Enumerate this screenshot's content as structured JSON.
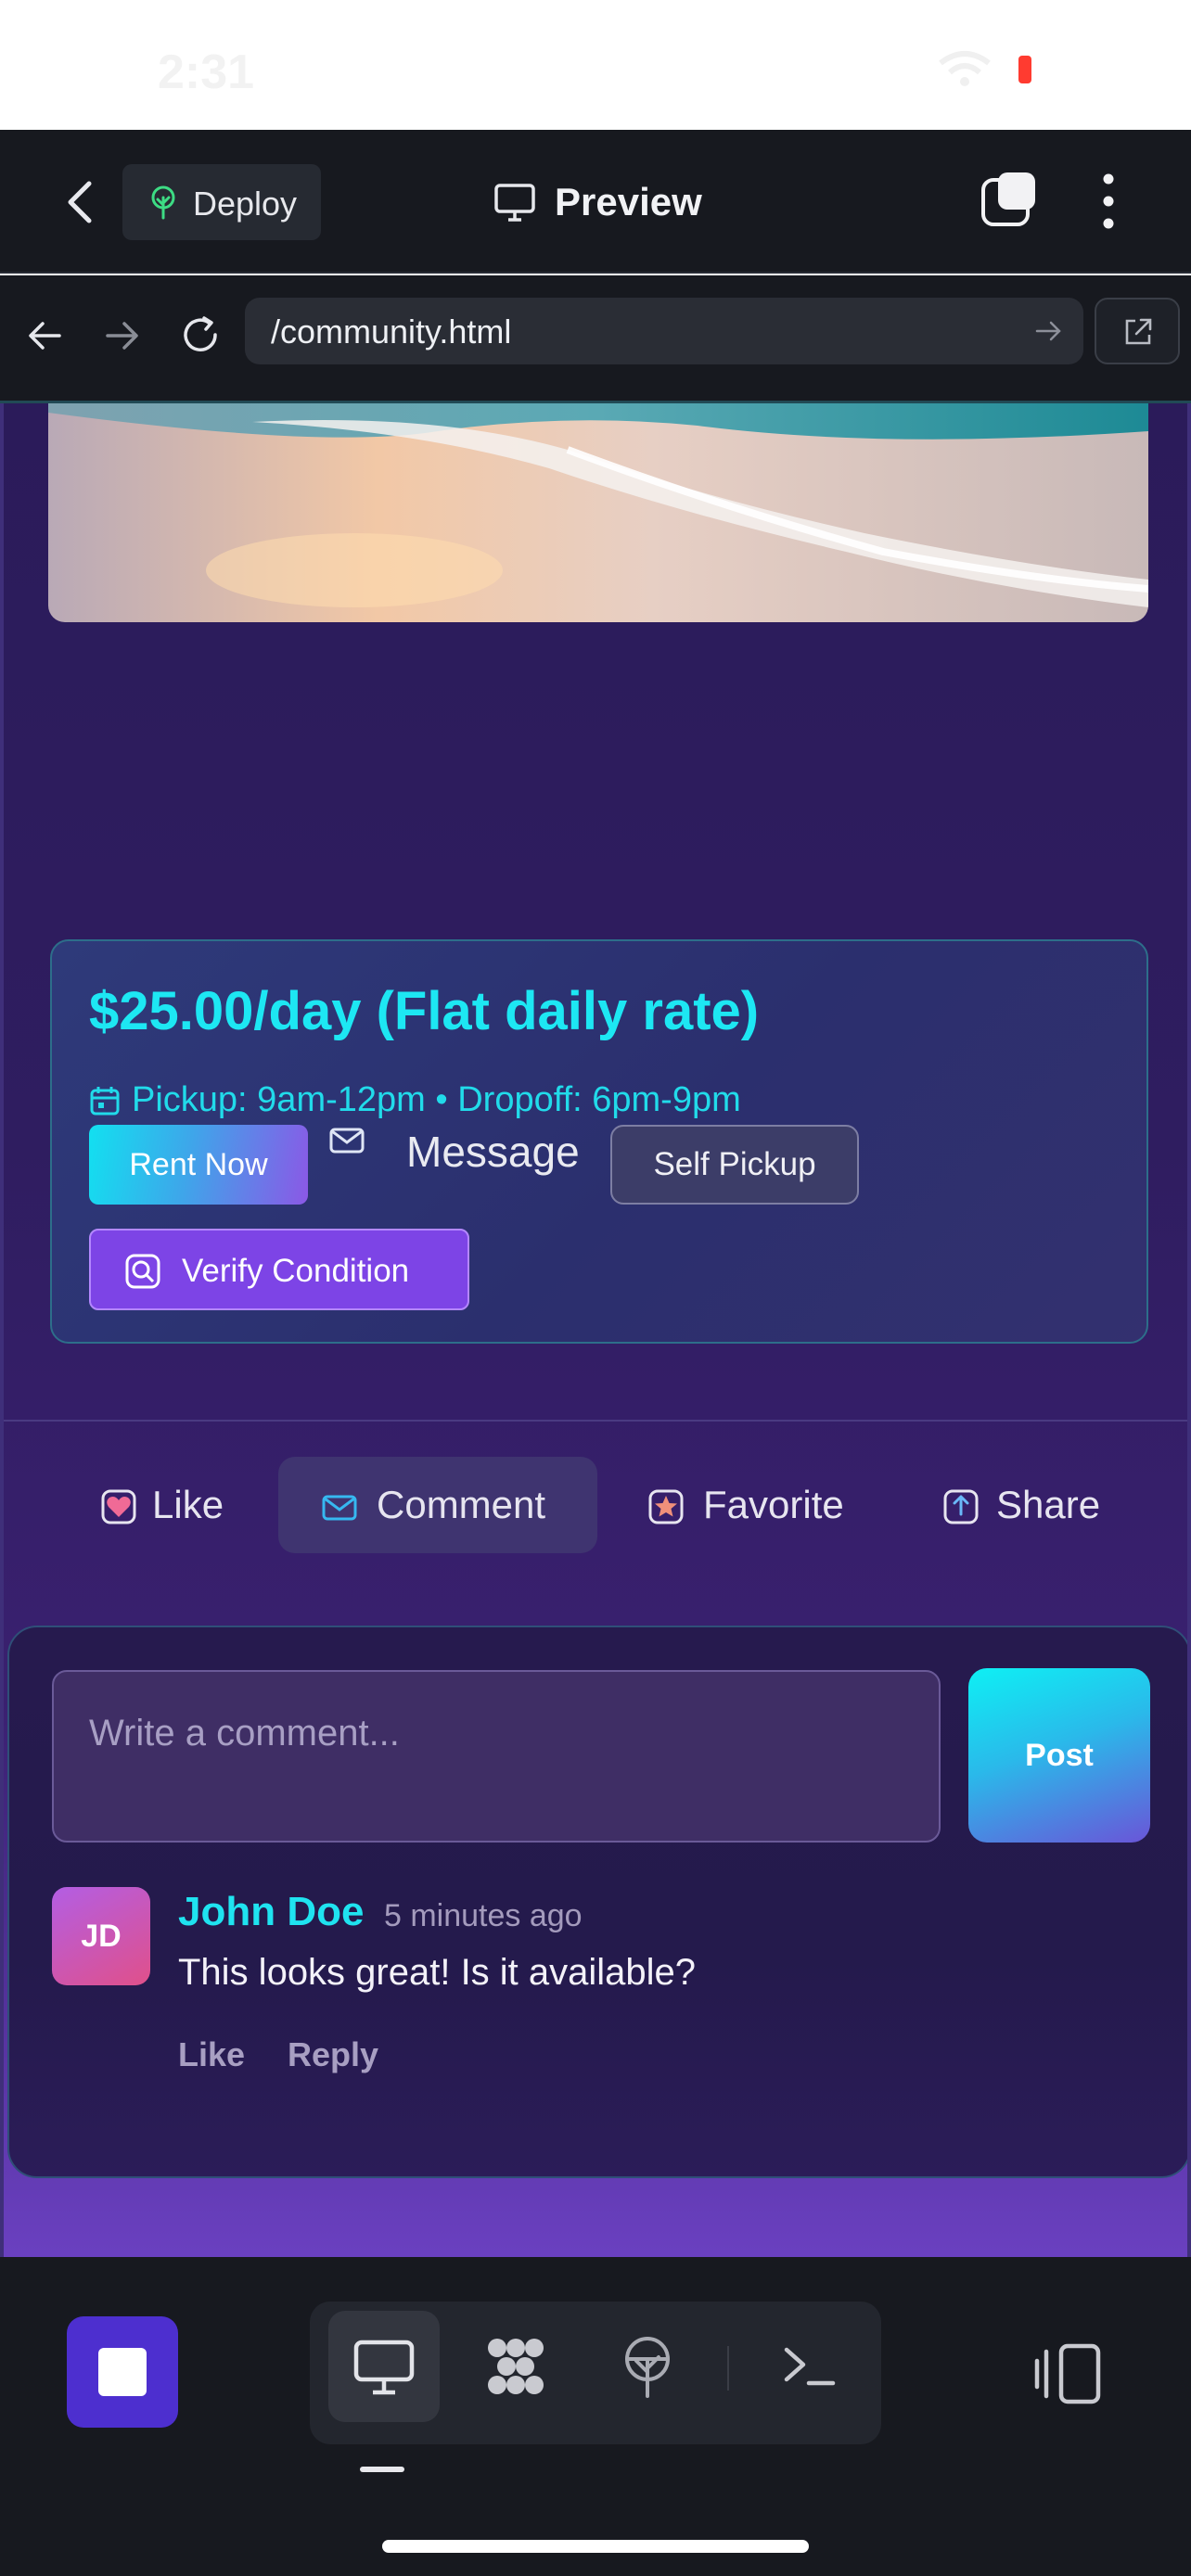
{
  "status": {
    "time": "2:31"
  },
  "appbar": {
    "deploy_label": "Deploy",
    "title": "Preview"
  },
  "browser": {
    "url": "/community.html"
  },
  "listing": {
    "price": "$25.00/day (Flat daily rate)",
    "pickup": "Pickup: 9am-12pm • Dropoff: 6pm-9pm",
    "rent_label": "Rent Now",
    "message_label": "Message",
    "self_pickup_label": "Self Pickup",
    "verify_label": "Verify Condition"
  },
  "actions": {
    "like": "Like",
    "comment": "Comment",
    "favorite": "Favorite",
    "share": "Share"
  },
  "comments": {
    "placeholder": "Write a comment...",
    "post_label": "Post",
    "items": [
      {
        "initials": "JD",
        "author": "John Doe",
        "time": "5 minutes ago",
        "text": "This looks great! Is it available?",
        "like": "Like",
        "reply": "Reply"
      }
    ]
  },
  "colors": {
    "accent_cyan": "#1de7f3",
    "accent_purple": "#7d44e6",
    "stop_button": "#4d2fcf"
  },
  "icons": {
    "back": "chevron-left-icon",
    "deploy": "tree-icon",
    "preview": "monitor-icon",
    "url_go": "arrow-right-icon",
    "external": "external-link-icon",
    "calendar": "calendar-icon",
    "message": "envelope-icon",
    "verify": "search-icon",
    "like": "heart-icon",
    "comment": "envelope-icon",
    "favorite": "star-icon",
    "share": "share-icon"
  }
}
